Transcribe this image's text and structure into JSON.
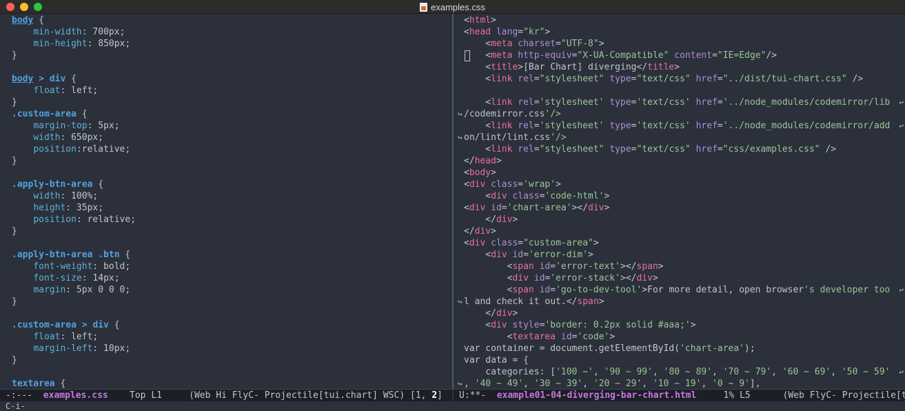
{
  "window": {
    "title": "examples.css"
  },
  "left": {
    "lines": [
      "body {",
      "    min-width: 700px;",
      "    min-height: 850px;",
      "}",
      "",
      "body > div {",
      "    float: left;",
      "}",
      ".custom-area {",
      "    margin-top: 5px;",
      "    width: 650px;",
      "    position:relative;",
      "}",
      "",
      ".apply-btn-area {",
      "    width: 100%;",
      "    height: 35px;",
      "    position: relative;",
      "}",
      "",
      ".apply-btn-area .btn {",
      "    font-weight: bold;",
      "    font-size: 14px;",
      "    margin: 5px 0 0 0;",
      "}",
      "",
      ".custom-area > div {",
      "    float: left;",
      "    margin-left: 10px;",
      "}",
      "",
      "textarea {"
    ],
    "modeline": {
      "status": "-:---  ",
      "buffer": "examples.css",
      "position": "    Top L1     (Web Hi FlyC- Projectile[tui.chart] WSC) [1, ",
      "col": "2",
      "tail": "]"
    }
  },
  "right": {
    "lines": [
      "<html>",
      "<head lang=\"kr\">",
      "    <meta charset=\"UTF-8\">",
      "    <meta http-equiv=\"X-UA-Compatible\" content=\"IE=Edge\"/>",
      "    <title>[Bar Chart] diverging</title>",
      "    <link rel=\"stylesheet\" type=\"text/css\" href=\"../dist/tui-chart.css\" />",
      "",
      "    <link rel='stylesheet' type='text/css' href='../node_modules/codemirror/lib",
      "/codemirror.css'/>",
      "    <link rel='stylesheet' type='text/css' href='../node_modules/codemirror/add",
      "on/lint/lint.css'/>",
      "    <link rel=\"stylesheet\" type=\"text/css\" href=\"css/examples.css\" />",
      "</head>",
      "<body>",
      "<div class='wrap'>",
      "    <div class='code-html'>",
      "<div id='chart-area'></div>",
      "    </div>",
      "</div>",
      "<div class=\"custom-area\">",
      "    <div id='error-dim'>",
      "        <span id='error-text'></span>",
      "        <div id='error-stack'></div>",
      "        <span id='go-to-dev-tool'>For more detail, open browser's developer too",
      "l and check it out.</span>",
      "    </div>",
      "    <div style='border: 0.2px solid #aaa;'>",
      "        <textarea id='code'>",
      "var container = document.getElementById('chart-area');",
      "var data = {",
      "    categories: ['100 ~', '90 ~ 99', '80 ~ 89', '70 ~ 79', '60 ~ 69', '50 ~ 59'",
      ", '40 ~ 49', '30 ~ 39', '20 ~ 29', '10 ~ 19', '0 ~ 9'],"
    ],
    "modeline": {
      "status": "U:**-  ",
      "buffer": "example01-04-diverging-bar-chart.html",
      "position": "     1% L5      (Web FlyC- Projectile[t"
    }
  },
  "minibuffer": {
    "text": "C-i-"
  },
  "glyphs": {
    "wrap": "↩",
    "continuation": "↪"
  },
  "colors": {
    "background": "#2b303b",
    "css_selector": "#4fa3e0",
    "css_property": "#5fb3d4",
    "html_tag": "#ec6fa0",
    "html_attr": "#b08cd8",
    "string": "#99c794",
    "text": "#c0c5ce",
    "modeline_buffer": "#c678dd"
  }
}
